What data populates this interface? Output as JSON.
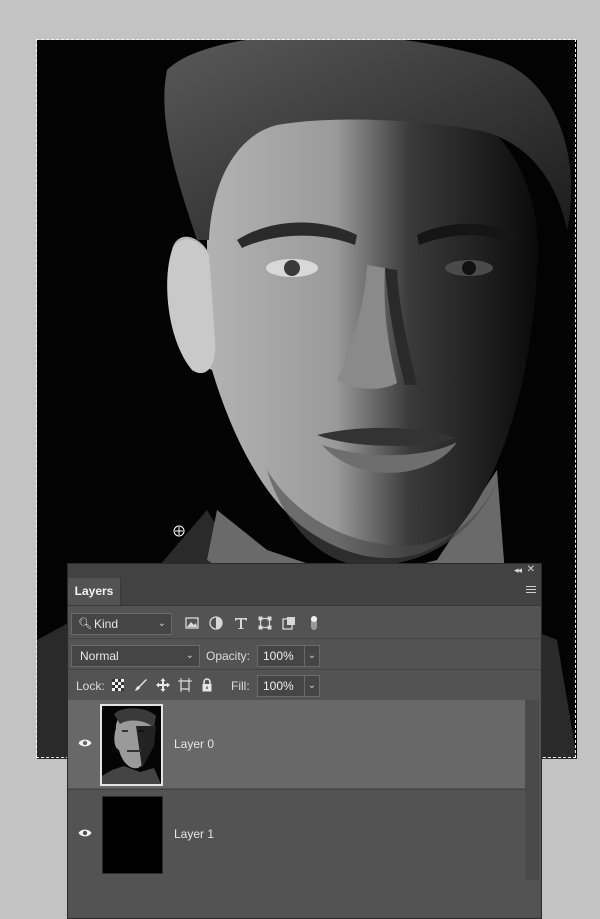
{
  "panel": {
    "tab_label": "Layers",
    "filter": {
      "kind_label": "Kind",
      "icons": [
        "image-filter-icon",
        "adjustment-filter-icon",
        "type-filter-icon",
        "shape-filter-icon",
        "smart-object-filter-icon",
        "filter-toggle-icon"
      ]
    },
    "blend": {
      "mode": "Normal",
      "opacity_label": "Opacity:",
      "opacity_value": "100%"
    },
    "lock": {
      "label": "Lock:",
      "icons": [
        "lock-transparent-pixels-icon",
        "lock-image-pixels-icon",
        "lock-position-icon",
        "lock-artboard-icon",
        "lock-all-icon"
      ],
      "fill_label": "Fill:",
      "fill_value": "100%"
    },
    "layers": [
      {
        "name": "Layer 0",
        "selected": true,
        "visible": true
      },
      {
        "name": "Layer 1",
        "selected": false,
        "visible": true
      }
    ]
  },
  "colors": {
    "panel_bg": "#535353",
    "selected_row": "#686868",
    "canvas_bg": "#030303",
    "workspace_bg": "#c3c3c3"
  }
}
